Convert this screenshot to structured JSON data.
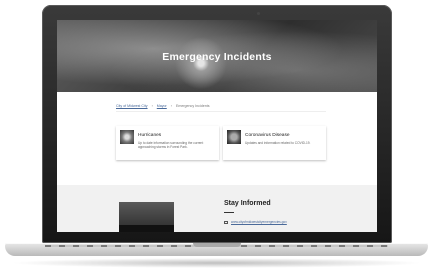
{
  "hero": {
    "title": "Emergency Incidents"
  },
  "breadcrumb": {
    "items": [
      "City of Midwest City",
      "Mayor",
      "Emergency Incidents"
    ]
  },
  "cards": [
    {
      "title": "Hurricanes",
      "description": "Up to date information surrounding the current approaching storms in Forest Park."
    },
    {
      "title": "Coronavirus Disease",
      "description": "Updates and information related to COVID-19."
    }
  ],
  "newsletter": {
    "title": "Stay Informed",
    "link_text": "www.cityofmidwestcityemergencies.gov"
  },
  "icons": [
    "mail-icon"
  ]
}
